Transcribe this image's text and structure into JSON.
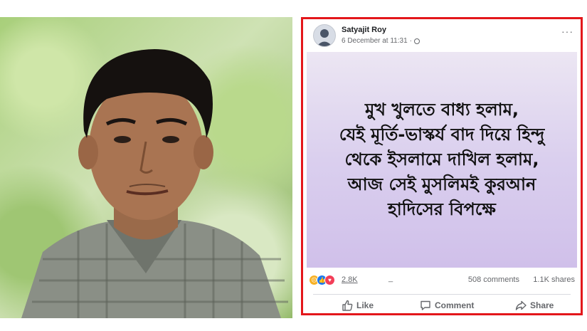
{
  "post": {
    "author": "Satyajit Roy",
    "date": "6 December at 11:31",
    "privacy_separator": "·",
    "more_glyph": "···",
    "text_lines": [
      "মুখ খুলতে বাধ্য হলাম,",
      "যেই মূর্তি-ভাস্কর্য বাদ দিয়ে হিন্দু",
      "থেকে ইসলামে দাখিল হলাম,",
      "আজ সেই মুসলিমই কুরআন",
      "হাদিসের বিপক্ষে"
    ],
    "reactions": {
      "count": "2.8K",
      "dash": "_",
      "comments": "508 comments",
      "shares": "1.1K shares"
    },
    "actions": {
      "like": "Like",
      "comment": "Comment",
      "share": "Share"
    }
  },
  "icons": [
    "sad-reaction-icon",
    "like-reaction-icon",
    "love-reaction-icon",
    "globe-icon",
    "more-icon",
    "like-icon",
    "comment-icon",
    "share-icon"
  ],
  "colors": {
    "highlight_border": "#e3171b",
    "post_background": "#d8ccec",
    "facebook_blue": "#1877f2"
  }
}
